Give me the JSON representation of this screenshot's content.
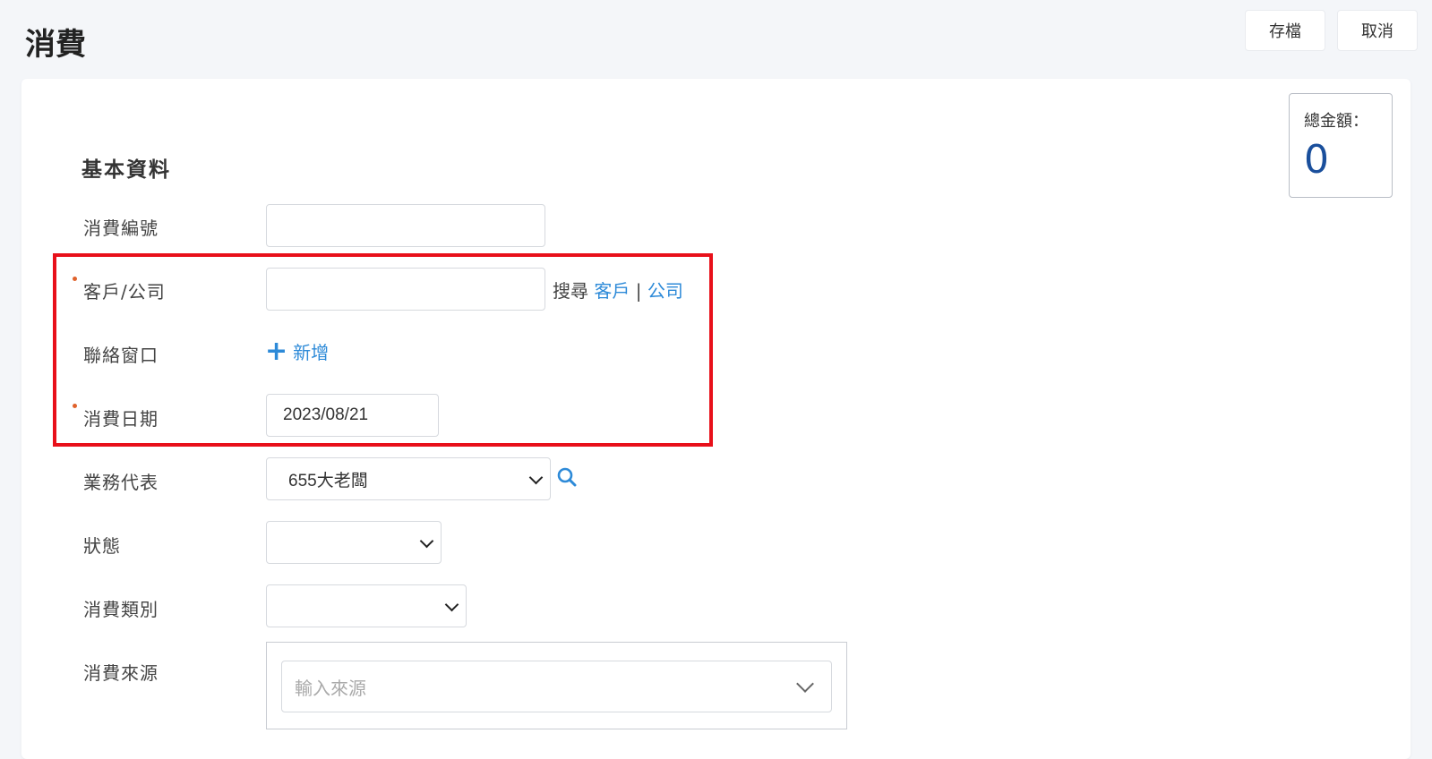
{
  "page": {
    "title": "消費"
  },
  "toolbar": {
    "save_label": "存檔",
    "cancel_label": "取消"
  },
  "total": {
    "label": "總金額：",
    "value": "0"
  },
  "section": {
    "title": "基本資料"
  },
  "fields": {
    "number": {
      "label": "消費編號",
      "value": ""
    },
    "customer": {
      "label": "客戶/公司",
      "value": "",
      "search_prefix": "搜尋",
      "search_customer": "客戶",
      "separator": "|",
      "search_company": "公司"
    },
    "contact": {
      "label": "聯絡窗口",
      "add_label": "新增"
    },
    "date": {
      "label": "消費日期",
      "value": "2023/08/21"
    },
    "rep": {
      "label": "業務代表",
      "value": "655大老闆"
    },
    "status": {
      "label": "狀態",
      "value": ""
    },
    "category": {
      "label": "消費類別",
      "value": ""
    },
    "source": {
      "label": "消費來源",
      "placeholder": "輸入來源"
    }
  },
  "colors": {
    "accent": "#2d8ad8",
    "highlight": "#e8101a",
    "total_value": "#1a4f9c",
    "required_dot": "#e0622c"
  },
  "icons": {
    "search": "search-icon",
    "plus": "plus-icon",
    "chevron": "chevron-down-icon"
  }
}
